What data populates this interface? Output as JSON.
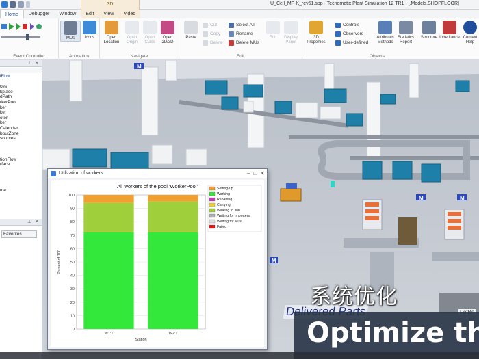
{
  "window": {
    "title": "U_Cell_MF-K_rev51.spp - Tecnomatix Plant Simulation 12 TR1 - [.Models.SHOPFLOOR]",
    "context_tab": "3D"
  },
  "tabs": [
    "Home",
    "Debugger",
    "Window",
    "Edit",
    "View",
    "Video"
  ],
  "active_tab": "Home",
  "ribbon": {
    "groups": {
      "event_controller": "Event Controller",
      "animation": "Animation",
      "navigate": "Navigate",
      "edit": "Edit",
      "objects": "Objects"
    },
    "buttons": {
      "mus": "MUs",
      "icons": "Icons",
      "open_location": "Open Location",
      "open_origin": "Open Origin",
      "open_class": "Open Class",
      "open_2d3d": "Open 2D/3D",
      "paste": "Paste",
      "cut": "Cut",
      "copy": "Copy",
      "delete": "Delete",
      "select_all": "Select All",
      "rename": "Rename",
      "delete_mus": "Delete MUs",
      "edit": "Edit",
      "display_panel": "Display Panel",
      "3d_properties": "3D Properties",
      "controls": "Controls",
      "observers": "Observers",
      "user_defined": "User-defined",
      "attributes_methods": "Attributes Methods",
      "statistics_report": "Statistics Report",
      "structure": "Structure",
      "inheritance": "Inheritance",
      "context_help": "Context Help"
    }
  },
  "left_panel": {
    "tree_items": [
      "lFlow",
      "",
      "ces",
      "kplace",
      "dPath",
      "rkerPool",
      "ker",
      "ker",
      "oter",
      "ker",
      "Calendar",
      "boutZone",
      "sources",
      "",
      "",
      "",
      "tionFlow",
      "rface",
      "",
      "",
      "",
      "",
      "me"
    ],
    "favorites_label": "Favorites"
  },
  "viewport": {
    "mu_labels": [
      "M",
      "M",
      "M",
      "M"
    ]
  },
  "chart_window": {
    "title": "Utilization of workers"
  },
  "chart_data": {
    "type": "bar",
    "stacked": true,
    "title": "All workers of the pool 'WorkerPool'",
    "xlabel": "Station",
    "ylabel": "Percent of 100",
    "ylim": [
      0,
      100
    ],
    "yticks": [
      0,
      10,
      20,
      30,
      40,
      50,
      60,
      70,
      80,
      90,
      100
    ],
    "categories": [
      "W1:1",
      "W2:1"
    ],
    "legend_position": "right",
    "series": [
      {
        "name": "Working",
        "color": "#33e83a",
        "values": [
          72,
          72
        ]
      },
      {
        "name": "Walking to Job",
        "color": "#9fcf3a",
        "values": [
          22,
          23
        ]
      },
      {
        "name": "Setting-up",
        "color": "#f0a030",
        "values": [
          6,
          5
        ]
      },
      {
        "name": "Repairing",
        "color": "#c23ab8",
        "values": [
          0,
          0
        ]
      },
      {
        "name": "Carrying",
        "color": "#e8d23a",
        "values": [
          0,
          0
        ]
      },
      {
        "name": "Waiting for Importers",
        "color": "#b0b0b0",
        "values": [
          0,
          0
        ]
      },
      {
        "name": "Waiting for Mus",
        "color": "#e0e0e0",
        "values": [
          0,
          0
        ]
      },
      {
        "name": "Failed",
        "color": "#e01818",
        "values": [
          0,
          0
        ]
      }
    ],
    "legend": [
      "Setting-up",
      "Working",
      "Repairing",
      "Carrying",
      "Walking to Job",
      "Waiting for Importers",
      "Waiting for Mus",
      "Failed"
    ],
    "legend_colors": [
      "#f0a030",
      "#33e83a",
      "#c23ab8",
      "#e8d23a",
      "#9fcf3a",
      "#b0b0b0",
      "#e0e0e0",
      "#e01818"
    ]
  },
  "overlay": {
    "subtitle_cn": "系统优化",
    "subtitle_en": "Optimize th",
    "delivered_text": "Delivered Parts",
    "fotbox_text": "FotBo"
  }
}
